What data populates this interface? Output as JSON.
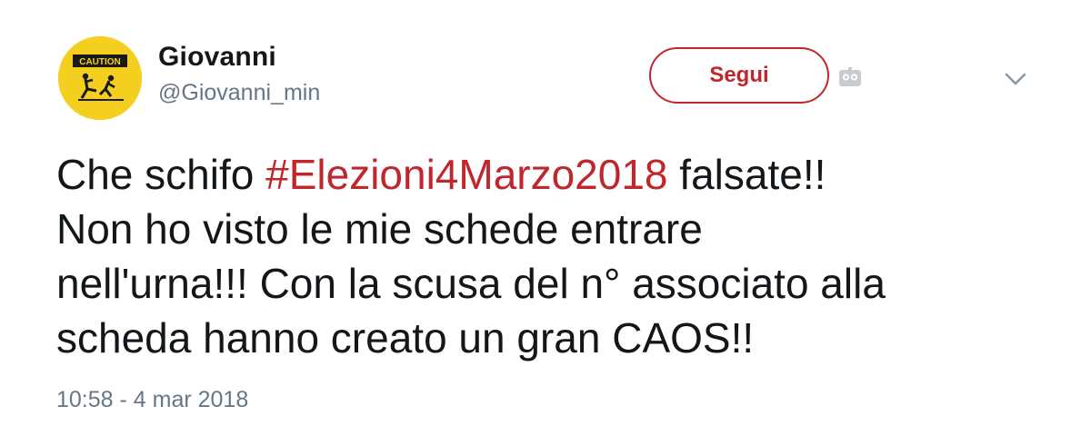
{
  "user": {
    "display_name": "Giovanni",
    "handle": "@Giovanni_min",
    "avatar_text": "CAUTION"
  },
  "actions": {
    "follow_label": "Segui",
    "icons": [
      "bot-icon",
      "chevron-down-icon"
    ]
  },
  "tweet": {
    "line1_pre": "Che schifo ",
    "hashtag": "#Elezioni4Marzo2018",
    "line1_post": " falsate!!",
    "line2": "Non ho visto le mie schede entrare",
    "line3": "nell'urna!!! Con la scusa del n° associato alla",
    "line4": "scheda hanno creato un gran CAOS!!"
  },
  "timestamp": "10:58 - 4 mar 2018",
  "colors": {
    "accent": "#c0272d",
    "text": "#14171a",
    "muted": "#657786",
    "avatar_bg": "#f4cf1f"
  }
}
